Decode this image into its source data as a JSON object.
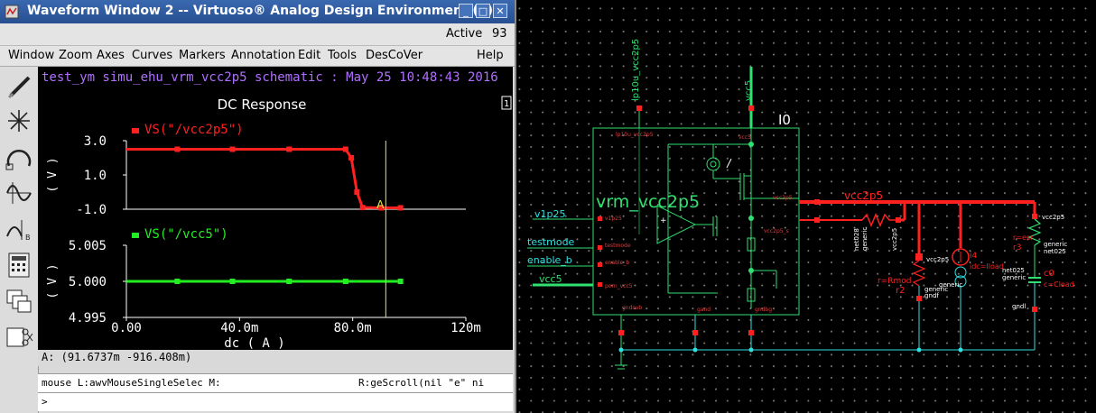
{
  "window": {
    "title": "Waveform Window 2 -- Virtuoso® Analog Design Environment (9)",
    "controls": [
      "_",
      "□",
      "✕"
    ]
  },
  "status": {
    "state": "Active",
    "number": "93"
  },
  "menu": [
    "Window",
    "Zoom",
    "Axes",
    "Curves",
    "Markers",
    "Annotation",
    "Edit",
    "Tools",
    "DesCoVer",
    "Help"
  ],
  "toolbar": [
    "pen-icon",
    "snowflake-icon",
    "undo-arc-icon",
    "sine-icon",
    "strip-icon",
    "calculator-icon",
    "windows-icon",
    "scissors-icon"
  ],
  "plot": {
    "header": "test_ym simu_ehu_vrm_vcc2p5 schematic : May 25 10:48:43 2016",
    "page_num": "1",
    "title": "DC Response",
    "xaxis_label": "dc ( A )",
    "marker_label": "A",
    "colors": {
      "bg": "#000000",
      "curve1": "#ff2020",
      "curve2": "#22ee22",
      "header": "#b070ff",
      "axis": "#ffffff",
      "marker": "#e8e850"
    }
  },
  "chart_data": [
    {
      "type": "line",
      "title": "DC Response",
      "xlabel": "dc ( A )",
      "ylabel": "(V)",
      "xlim": [
        0,
        0.12
      ],
      "ylim": [
        -1.0,
        3.0
      ],
      "yticks": [
        "3.0",
        "1.0",
        "-1.0"
      ],
      "xticks": [
        "0.00",
        "40.0m",
        "80.0m",
        "120m"
      ],
      "series": [
        {
          "name": "VS(\"/vcc2p5\")",
          "x": [
            0,
            0.018,
            0.0375,
            0.0575,
            0.0775,
            0.0795,
            0.0815,
            0.0835,
            0.09,
            0.0969
          ],
          "y": [
            2.5,
            2.5,
            2.5,
            2.5,
            2.5,
            2.0,
            0.0,
            -0.9,
            -0.92,
            -0.92
          ]
        }
      ]
    },
    {
      "type": "line",
      "xlabel": "dc ( A )",
      "ylabel": "(V)",
      "xlim": [
        0,
        0.12
      ],
      "ylim": [
        4.995,
        5.005
      ],
      "yticks": [
        "5.005",
        "5.000",
        "4.995"
      ],
      "xticks": [
        "0.00",
        "40.0m",
        "80.0m",
        "120m"
      ],
      "series": [
        {
          "name": "VS(\"/vcc5\")",
          "x": [
            0,
            0.018,
            0.0375,
            0.0575,
            0.0775,
            0.0969
          ],
          "y": [
            5.0,
            5.0,
            5.0,
            5.0,
            5.0,
            5.0
          ]
        }
      ]
    }
  ],
  "marker_readout": "A: (91.6737m -916.408m)",
  "mouse_line": {
    "left": "mouse L:awvMouseSingleSelec M:",
    "right": "R:geScroll(nil \"e\" ni"
  },
  "prompt": ">",
  "schematic": {
    "instance_id": "I0",
    "cell_name": "vrm_vcc2p5",
    "pins": {
      "lp10u": "lp10u_vcc2p5",
      "vcc5_top": "vcc5",
      "v1p25": "v1p25",
      "testmode": "testmode",
      "enable_b": "enable_b",
      "vcc5_in": "vcc5"
    },
    "inner_labels": {
      "lp10u": "lp10u_vcc2p5",
      "vcc5": "vcc5",
      "vcc2p5": "vcc2p5",
      "v1p25": "v1p25",
      "testmode": "testmode",
      "enable_b": "enable_b",
      "porn": "porn_vcc5",
      "vcc2p5_s": "vcc2p5_s",
      "gndsub": "gndsub",
      "gand": "gand",
      "gndbg": "gndbg"
    },
    "net_vcc2p5": "vcc2p5",
    "net028": "net028",
    "generic": "generic",
    "vcc2p5_small": "vcc2p5",
    "r_mod": "r=Rmod",
    "r2": "r2",
    "gndf": "gndf",
    "i4": "i4",
    "idc": "idc=Iload",
    "vcc2p5_label": "vcc2p5",
    "r_esr": "r=esr",
    "r3": "r3",
    "net025": "net025",
    "c0": "c0",
    "c_cload": "c=Cload",
    "gndl": "gndl"
  }
}
